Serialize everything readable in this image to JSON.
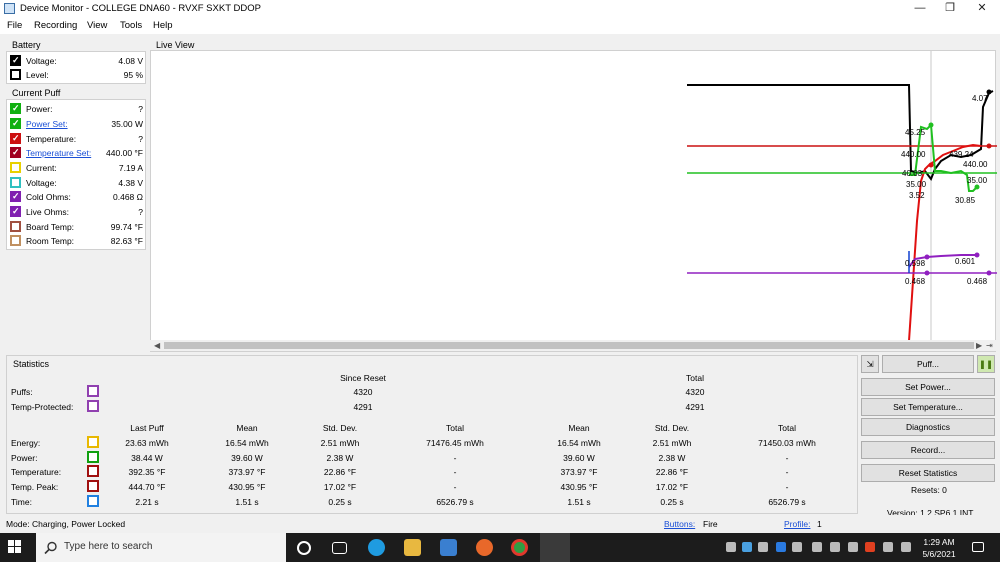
{
  "window": {
    "title": "Device Monitor - COLLEGE DNA60 - RVXF SXKT DDOP",
    "minimize": "—",
    "maximize": "❐",
    "close": "✕"
  },
  "menu": [
    "File",
    "Recording",
    "View",
    "Tools",
    "Help"
  ],
  "battery": {
    "title": "Battery",
    "rows": [
      {
        "label": "Voltage:",
        "value": "4.08 V",
        "checked": true,
        "color": "#000000"
      },
      {
        "label": "Level:",
        "value": "95 %",
        "checked": false,
        "color": "#000000"
      }
    ]
  },
  "current_puff": {
    "title": "Current Puff",
    "rows": [
      {
        "label": "Power:",
        "value": "?",
        "checked": true,
        "color": "#10b010",
        "link": false
      },
      {
        "label": "Power Set:",
        "value": "35.00 W",
        "checked": true,
        "color": "#10b010",
        "link": true
      },
      {
        "label": "Temperature:",
        "value": "?",
        "checked": true,
        "color": "#cc1010",
        "link": false
      },
      {
        "label": "Temperature Set:",
        "value": "440.00 °F",
        "checked": true,
        "color": "#a00020",
        "link": true
      },
      {
        "label": "Current:",
        "value": "7.19 A",
        "checked": false,
        "color": "#e8d000",
        "link": false
      },
      {
        "label": "Voltage:",
        "value": "4.38 V",
        "checked": false,
        "color": "#30c0c0",
        "link": false
      },
      {
        "label": "Cold Ohms:",
        "value": "0.468 Ω",
        "checked": true,
        "color": "#8020b0",
        "link": false
      },
      {
        "label": "Live Ohms:",
        "value": "?",
        "checked": true,
        "color": "#8020b0",
        "link": false
      },
      {
        "label": "Board Temp:",
        "value": "99.74 °F",
        "checked": false,
        "color": "#a05040",
        "link": false
      },
      {
        "label": "Room Temp:",
        "value": "82.63 °F",
        "checked": false,
        "color": "#c09060",
        "link": false
      }
    ]
  },
  "live_view": {
    "title": "Live View",
    "labels": [
      "4.07",
      "45.25",
      "440.00",
      "439.24",
      "440.00",
      "40.63",
      "35.00",
      "35.00",
      "3.52",
      "30.85",
      "0.598",
      "0.601",
      "0.468",
      "0.468"
    ],
    "colors": {
      "battery": "#000000",
      "temp_set": "#cc1010",
      "power": "#20c020",
      "ohms": "#9020c0"
    }
  },
  "statistics": {
    "title": "Statistics",
    "since_reset": "Since Reset",
    "total": "Total",
    "puffs": {
      "label": "Puffs:",
      "since": "4320",
      "total": "4320",
      "color": "#9040b0"
    },
    "temp_protected": {
      "label": "Temp-Protected:",
      "since": "4291",
      "total": "4291",
      "color": "#9040b0"
    },
    "headers": [
      "Last Puff",
      "Mean",
      "Std. Dev.",
      "Total",
      "Mean",
      "Std. Dev.",
      "Total"
    ],
    "rows": [
      {
        "label": "Energy:",
        "color": "#e8b800",
        "values": [
          "23.63 mWh",
          "16.54 mWh",
          "2.51 mWh",
          "71476.45 mWh",
          "16.54 mWh",
          "2.51 mWh",
          "71450.03 mWh"
        ]
      },
      {
        "label": "Power:",
        "color": "#10a010",
        "values": [
          "38.44 W",
          "39.60 W",
          "2.38 W",
          "-",
          "39.60 W",
          "2.38 W",
          "-"
        ]
      },
      {
        "label": "Temperature:",
        "color": "#a01010",
        "values": [
          "392.35 °F",
          "373.97 °F",
          "22.86 °F",
          "-",
          "373.97 °F",
          "22.86 °F",
          "-"
        ]
      },
      {
        "label": "Temp. Peak:",
        "color": "#a01010",
        "values": [
          "444.70 °F",
          "430.95 °F",
          "17.02 °F",
          "-",
          "430.95 °F",
          "17.02 °F",
          "-"
        ]
      },
      {
        "label": "Time:",
        "color": "#2080e0",
        "values": [
          "2.21 s",
          "1.51 s",
          "0.25 s",
          "6526.79 s",
          "1.51 s",
          "0.25 s",
          "6526.79 s"
        ]
      }
    ]
  },
  "side": {
    "puff": "Puff...",
    "set_power": "Set Power...",
    "set_temperature": "Set Temperature...",
    "diagnostics": "Diagnostics",
    "record": "Record...",
    "reset_statistics": "Reset Statistics",
    "resets": "Resets: 0",
    "version": "Version: 1.2 SP6.1 INT"
  },
  "status": {
    "mode": "Mode: Charging, Power Locked",
    "buttons_label": "Buttons:",
    "buttons_value": "Fire",
    "profile_label": "Profile:",
    "profile_value": "1"
  },
  "taskbar": {
    "search_placeholder": "Type here to search",
    "time": "1:29 AM",
    "date": "5/6/2021"
  }
}
